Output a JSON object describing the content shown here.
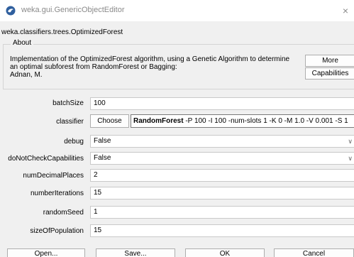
{
  "window": {
    "title": "weka.gui.GenericObjectEditor",
    "close_glyph": "×"
  },
  "class_name": "weka.classifiers.trees.OptimizedForest",
  "about": {
    "legend": "About",
    "text_line1": "Implementation of the OptimizedForest algorithm, using a Genetic Algorithm to determine",
    "text_line2": "an optimal subforest from RandomForest or Bagging:",
    "text_line3": "Adnan, M.",
    "more_label": "More",
    "capabilities_label": "Capabilities"
  },
  "properties": {
    "batchSize": {
      "label": "batchSize",
      "value": "100"
    },
    "classifier": {
      "label": "classifier",
      "choose_label": "Choose",
      "name": "RandomForest",
      "options": " -P 100 -I 100 -num-slots 1 -K 0 -M 1.0 -V 0.001 -S 1"
    },
    "debug": {
      "label": "debug",
      "value": "False",
      "arrow": "∨"
    },
    "doNotCheckCapabilities": {
      "label": "doNotCheckCapabilities",
      "value": "False",
      "arrow": "∨"
    },
    "numDecimalPlaces": {
      "label": "numDecimalPlaces",
      "value": "2"
    },
    "numberIterations": {
      "label": "numberIterations",
      "value": "15"
    },
    "randomSeed": {
      "label": "randomSeed",
      "value": "1"
    },
    "sizeOfPopulation": {
      "label": "sizeOfPopulation",
      "value": "15"
    }
  },
  "buttons": {
    "open": "Open...",
    "save": "Save...",
    "ok": "OK",
    "cancel": "Cancel"
  },
  "icons": {
    "app": "weka-bird-icon"
  }
}
